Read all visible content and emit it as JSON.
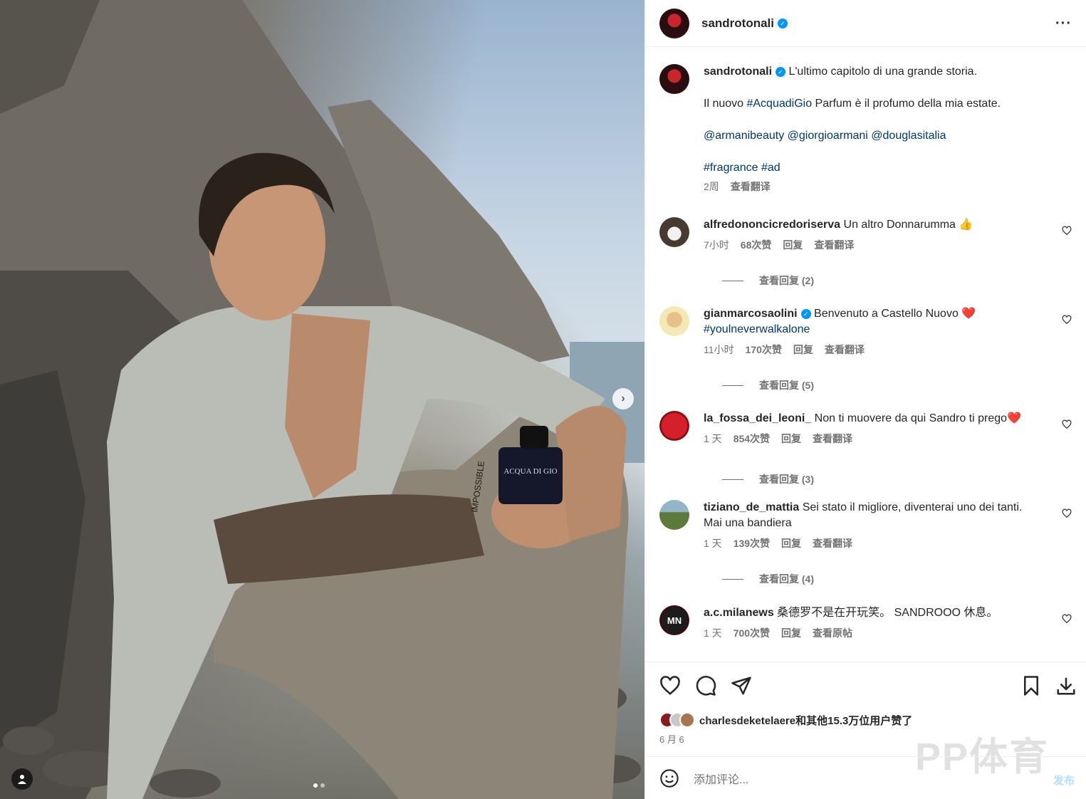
{
  "post": {
    "username": "sandrotonali",
    "more_icon": "more-horizontal-icon",
    "caption": {
      "line1": "L'ultimo capitolo di una grande storia.",
      "line2_pre": "Il nuovo ",
      "line2_tag": "#AcquadiGio",
      "line2_post": " Parfum è il profumo della mia estate.",
      "mention1": "@armanibeauty",
      "mention2": "@giorgioarmani",
      "mention3": "@douglasitalia",
      "tag1": "#fragrance",
      "tag2": "#ad",
      "time": "2周",
      "translate": "查看翻译"
    }
  },
  "comments": [
    {
      "user": "alfredononcicredoriserva",
      "text": "Un altro Donnarumma 👍",
      "time": "7小时",
      "likes": "68次赞",
      "reply": "回复",
      "translate": "查看翻译",
      "replies": "查看回复 (2)"
    },
    {
      "user": "gianmarcosaolini",
      "text": "Benvenuto a Castello Nuovo ❤️",
      "tag": "#youlneverwalkalone",
      "time": "11小时",
      "likes": "170次赞",
      "reply": "回复",
      "translate": "查看翻译",
      "replies": "查看回复 (5)"
    },
    {
      "user": "la_fossa_dei_leoni_",
      "text": "Non ti muovere da qui Sandro ti prego❤️",
      "time": "1 天",
      "likes": "854次赞",
      "reply": "回复",
      "translate": "查看翻译",
      "replies": "查看回复 (3)"
    },
    {
      "user": "tiziano_de_mattia",
      "text": "Sei stato il migliore, diventerai uno dei tanti. Mai una bandiera",
      "time": "1 天",
      "likes": "139次赞",
      "reply": "回复",
      "translate": "查看翻译",
      "replies": "查看回复 (4)"
    },
    {
      "user": "a.c.milanews",
      "text": "桑德罗不是在开玩笑。 SANDROOO 休息。",
      "time": "1 天",
      "likes": "700次赞",
      "reply": "回复",
      "translate": "查看原帖",
      "avatar_text": "MN"
    }
  ],
  "actions": {
    "liked_by_user": "charlesdeketelaere",
    "liked_by_rest": "和其他15.3万位用户赞了",
    "date": "6 月 6",
    "watermark": "PP体育"
  },
  "add_comment": {
    "placeholder": "添加评论...",
    "publish": "发布"
  },
  "photo": {
    "product_text": "ACQUA DI GIO",
    "tattoo_text": "IMPOSSIBLE"
  }
}
